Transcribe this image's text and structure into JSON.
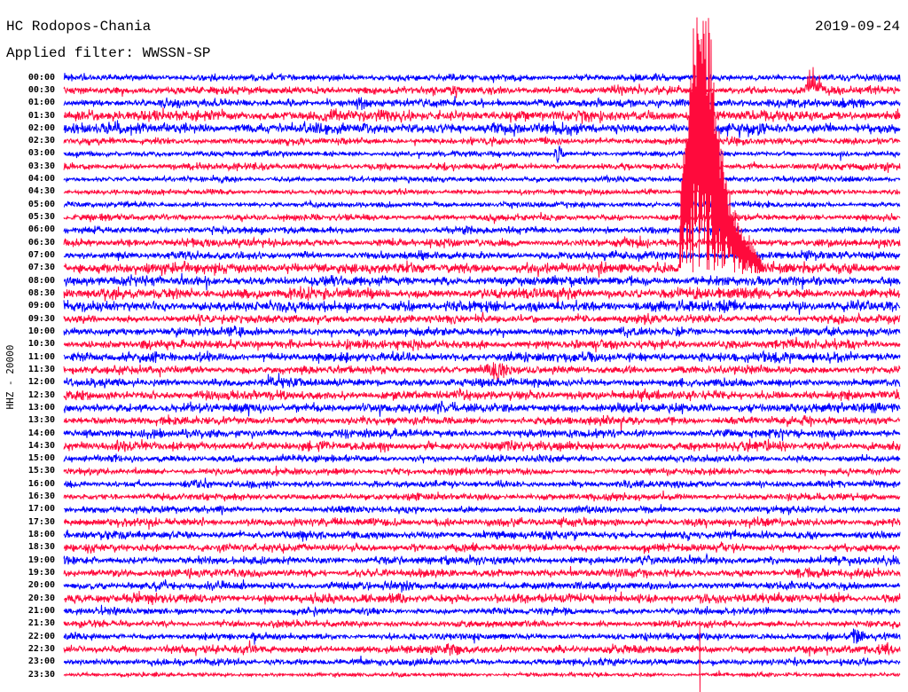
{
  "chart_data": {
    "type": "line",
    "title": "HC Rodopos-Chania",
    "subtitle": "Applied filter: WWSSN-SP",
    "date": "2019-09-24",
    "xlabel": "",
    "ylabel": "HHZ - 20000",
    "y_tick_labels": [
      "00:00",
      "00:30",
      "01:00",
      "01:30",
      "02:00",
      "02:30",
      "03:00",
      "03:30",
      "04:00",
      "04:30",
      "05:00",
      "05:30",
      "06:00",
      "06:30",
      "07:00",
      "07:30",
      "08:00",
      "08:30",
      "09:00",
      "09:30",
      "10:00",
      "10:30",
      "11:00",
      "11:30",
      "12:00",
      "12:30",
      "13:00",
      "13:30",
      "14:00",
      "14:30",
      "15:00",
      "15:30",
      "16:00",
      "16:30",
      "17:00",
      "17:30",
      "18:00",
      "18:30",
      "19:00",
      "19:30",
      "20:00",
      "20:30",
      "21:00",
      "21:30",
      "22:00",
      "22:30",
      "23:00",
      "23:30"
    ],
    "series_colors": [
      "#0000ff",
      "#ff0a3c"
    ],
    "grid": false,
    "legend": "none"
  }
}
